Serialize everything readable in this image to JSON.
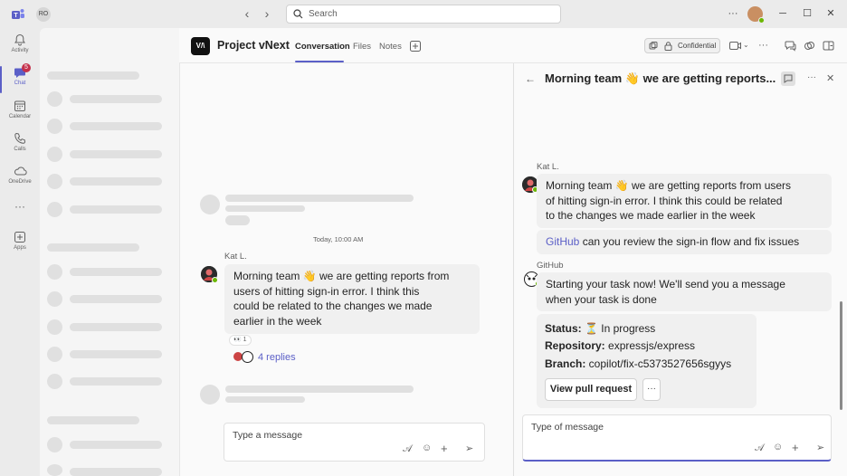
{
  "titlebar": {
    "profile_initials": "RO",
    "search_placeholder": "Search"
  },
  "rail": {
    "items": [
      {
        "label": "Activity",
        "icon": "bell-icon"
      },
      {
        "label": "Chat",
        "icon": "chat-icon",
        "badge": "5"
      },
      {
        "label": "Calendar",
        "icon": "calendar-icon"
      },
      {
        "label": "Calls",
        "icon": "phone-icon"
      },
      {
        "label": "OneDrive",
        "icon": "cloud-icon"
      },
      {
        "label": "Apps",
        "icon": "add-app-icon"
      }
    ],
    "more": "···"
  },
  "header": {
    "logo_text": "V/\\",
    "title": "Project vNext",
    "tabs": [
      "Conversation",
      "Files",
      "Notes"
    ],
    "confidential_label": "Confidential"
  },
  "conversation": {
    "date_separator": "Today, 10:00 AM",
    "message": {
      "sender": "Kat L.",
      "line1": "Morning team 👋 we are getting reports from",
      "line2": "users of hitting sign-in error. I think this",
      "line3": "could be related to the changes we made",
      "line4": "earlier in the week",
      "reaction_count": "1",
      "replies": "4 replies"
    },
    "compose_placeholder": "Type a message"
  },
  "thread": {
    "title": "Morning team 👋  we are getting reports...",
    "kat": {
      "sender": "Kat L.",
      "line1": "Morning team 👋 we are getting reports from users",
      "line2": "of hitting sign-in error. I think this could be related",
      "line3": "to the changes we made earlier in the week",
      "mention": "GitHub",
      "followup": " can you review the sign-in flow and fix issues"
    },
    "github": {
      "sender": "GitHub",
      "line1": "Starting your task now! We'll send you a message",
      "line2": "when your task is done",
      "status_label": "Status:",
      "status_value": " ⏳ In progress",
      "repo_label": "Repository:",
      "repo_value": " expressjs/express",
      "branch_label": "Branch:",
      "branch_value": " copilot/fix-c5373527656sgyys",
      "button": "View pull request",
      "more": "···"
    },
    "compose_placeholder": "Type of message"
  }
}
